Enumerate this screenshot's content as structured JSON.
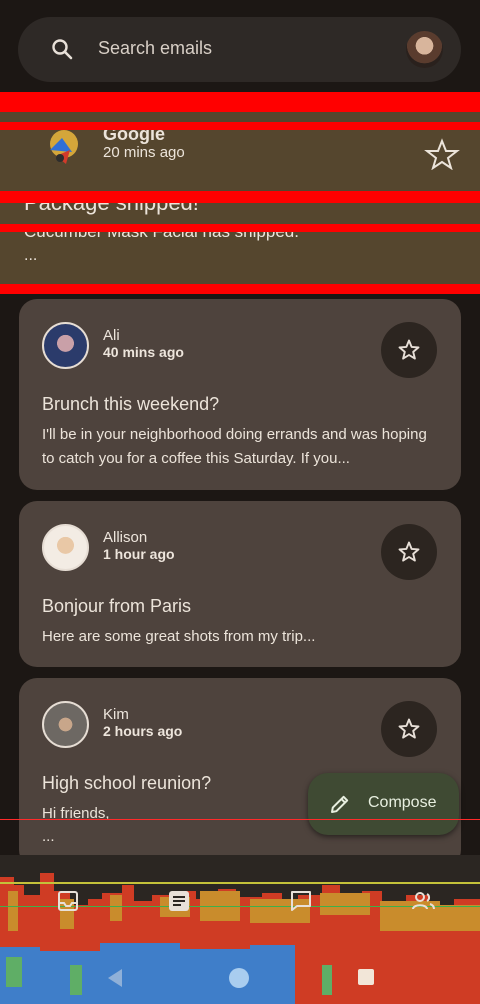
{
  "search": {
    "placeholder": "Search emails"
  },
  "glitched_item": {
    "sender": "Google",
    "time": "20 mins ago",
    "subject": "Package shipped!",
    "body": "Cucumber Mask Facial has shipped.",
    "more": "..."
  },
  "emails": [
    {
      "sender": "Ali",
      "time": "40 mins ago",
      "subject": "Brunch this weekend?",
      "body": "I'll be in your neighborhood doing errands and was hoping to catch you for a coffee this Saturday. If you...",
      "avatar_color": "#2b3b6b"
    },
    {
      "sender": "Allison",
      "time": "1 hour ago",
      "subject": "Bonjour from Paris",
      "body": "Here are some great shots from my trip...",
      "avatar_color": "#f0e6dc"
    },
    {
      "sender": "Kim",
      "time": "2 hours ago",
      "subject": "High school reunion?",
      "body": "Hi friends,",
      "more": "...",
      "avatar_color": "#7a7570"
    }
  ],
  "compose": {
    "label": "Compose"
  },
  "colors": {
    "background": "#1c1714",
    "card": "#4e433d",
    "fab": "#3f4a33",
    "glitch_band": "#ff0000"
  },
  "bottom_nav": [
    "inbox-icon",
    "article-icon",
    "chat-icon",
    "contacts-icon"
  ],
  "system_nav": [
    "back-icon",
    "home-icon",
    "recents-icon"
  ]
}
